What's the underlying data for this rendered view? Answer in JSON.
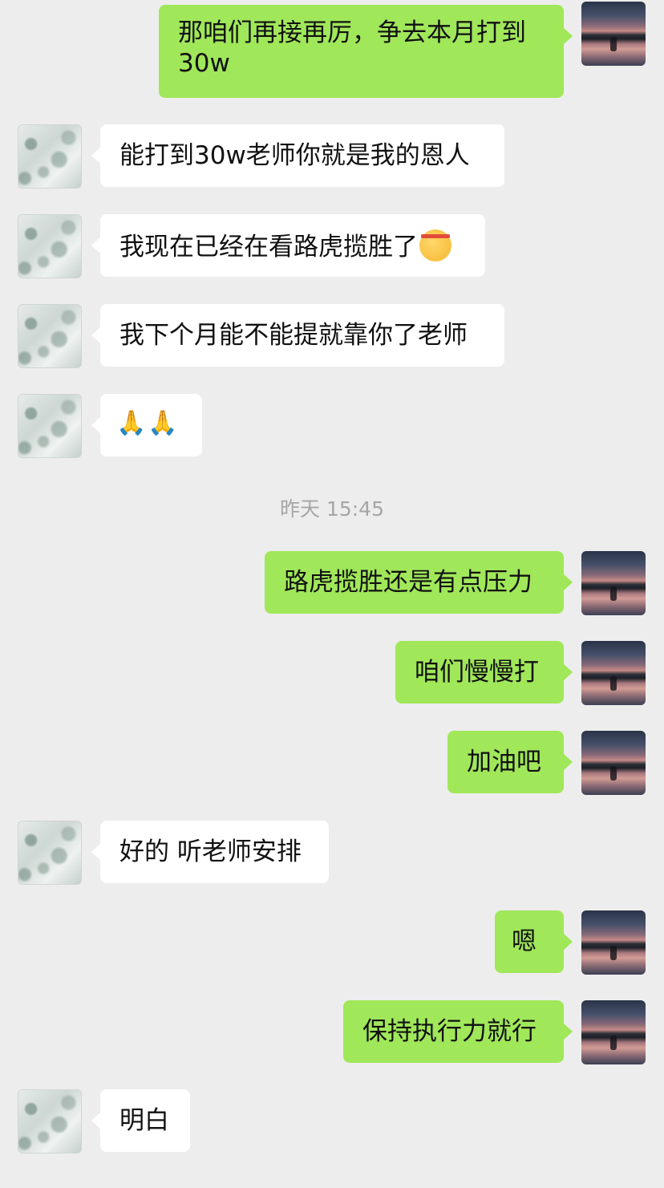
{
  "messages": [
    {
      "side": "right",
      "text": "那咱们再接再厉，争去本月打到30w"
    },
    {
      "side": "left",
      "text": "能打到30w老师你就是我的恩人"
    },
    {
      "side": "left",
      "text": "我现在已经在看路虎揽胜了"
    },
    {
      "side": "left",
      "text": "我下个月能不能提就靠你了老师"
    },
    {
      "side": "left",
      "text": "🙏🙏"
    },
    {
      "side": "right",
      "text": "路虎揽胜还是有点压力"
    },
    {
      "side": "right",
      "text": "咱们慢慢打"
    },
    {
      "side": "right",
      "text": "加油吧"
    },
    {
      "side": "left",
      "text": "好的 听老师安排"
    },
    {
      "side": "right",
      "text": "嗯"
    },
    {
      "side": "right",
      "text": "保持执行力就行"
    },
    {
      "side": "left",
      "text": "明白"
    }
  ],
  "timestamp": "昨天 15:45",
  "emoji": {
    "face": "saluting-face-headband",
    "hands": "folded-hands"
  },
  "colors": {
    "background": "#ededed",
    "sent_bubble": "#a0e75a",
    "received_bubble": "#ffffff",
    "timestamp_text": "#a6a6a6"
  }
}
